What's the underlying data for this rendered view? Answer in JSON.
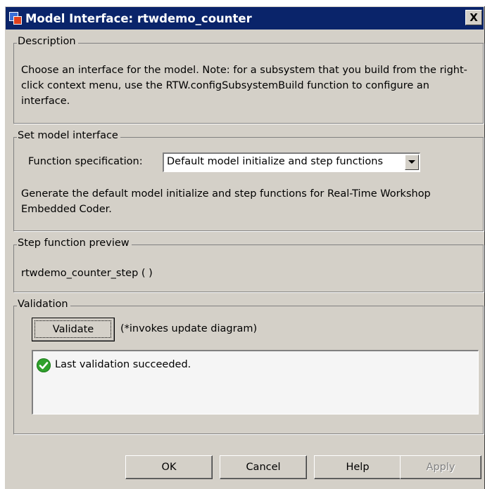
{
  "window": {
    "title": "Model Interface: rtwdemo_counter",
    "close_glyph": "X"
  },
  "description": {
    "legend": "Description",
    "text": "Choose an interface for the model. Note: for a subsystem that you build from the right-click context menu, use the RTW.configSubsystemBuild function to configure an interface."
  },
  "model_interface": {
    "legend": "Set model interface",
    "function_spec_label": "Function specification:",
    "function_spec_value": "Default model initialize and step functions",
    "help_text": "Generate the default model initialize and step functions for Real-Time Workshop Embedded Coder."
  },
  "step_preview": {
    "legend": "Step function preview",
    "text": "rtwdemo_counter_step ( )"
  },
  "validation": {
    "legend": "Validation",
    "validate_label": "Validate",
    "note": "(*invokes update diagram)",
    "result_text": "Last validation succeeded.",
    "status_color": "#2fa12c"
  },
  "buttons": {
    "ok": "OK",
    "cancel": "Cancel",
    "help": "Help",
    "apply": "Apply"
  },
  "colors": {
    "titlebar": "#0a246a",
    "dialog": "#d4d0c8"
  }
}
